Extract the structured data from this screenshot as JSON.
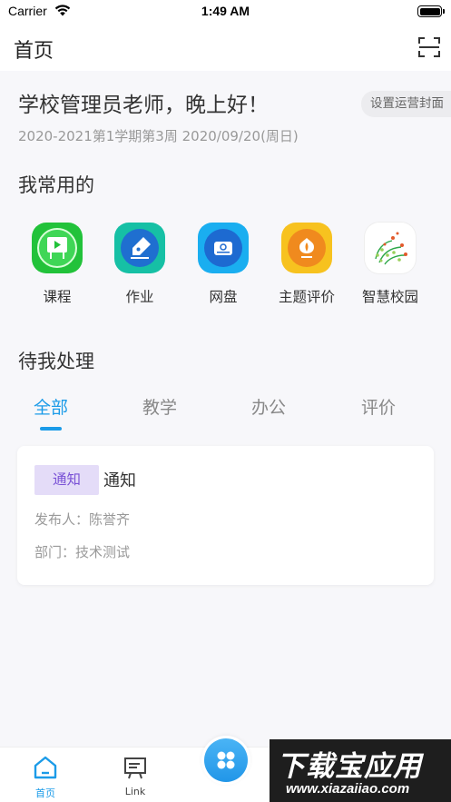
{
  "status_bar": {
    "carrier": "Carrier",
    "time": "1:49 AM"
  },
  "nav": {
    "title": "首页",
    "scan_icon": "scan-icon"
  },
  "greeting": {
    "text": "学校管理员老师，晚上好！",
    "cover_button": "设置运营封面",
    "semester": "2020-2021第1学期第3周 2020/09/20(周日)"
  },
  "frequent": {
    "title": "我常用的",
    "items": [
      {
        "label": "课程",
        "icon": "course-icon",
        "color": "#22c23a"
      },
      {
        "label": "作业",
        "icon": "homework-icon",
        "color": "#16c0a5"
      },
      {
        "label": "网盘",
        "icon": "cloud-disk-icon",
        "color": "#1aaef0"
      },
      {
        "label": "主题评价",
        "icon": "theme-evaluation-icon",
        "color": "#f7c21f"
      },
      {
        "label": "智慧校园",
        "icon": "smart-campus-icon",
        "color": "#ffffff"
      }
    ]
  },
  "pending": {
    "title": "待我处理",
    "tabs": [
      "全部",
      "教学",
      "办公",
      "评价"
    ],
    "active_tab": "全部",
    "accent": "#1b9be8",
    "card": {
      "badge": "通知",
      "title": "通知",
      "publisher": "发布人：陈誉齐",
      "department": "部门：技术测试"
    }
  },
  "tabbar": {
    "items": [
      {
        "label": "首页",
        "icon": "home-icon",
        "active": true
      },
      {
        "label": "Link",
        "icon": "link-board-icon",
        "active": false
      }
    ],
    "center_icon": "apps-grid-icon"
  },
  "watermark": {
    "main": "下载宝应用",
    "sub": "www.xiazaiiao.com"
  }
}
